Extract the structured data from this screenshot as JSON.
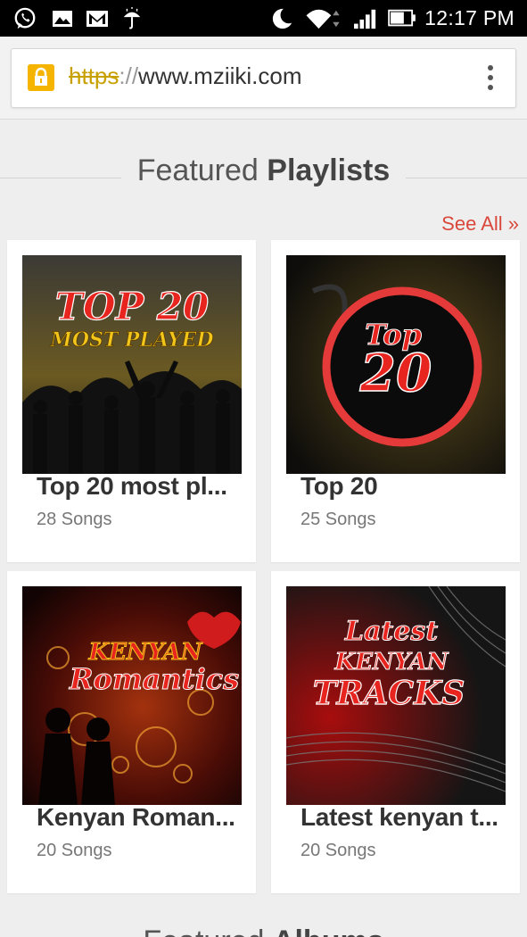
{
  "status_bar": {
    "time": "12:17 PM",
    "icons": [
      "whatsapp-icon",
      "gallery-icon",
      "gmail-icon",
      "umbrella-icon",
      "moon-icon",
      "wifi-icon",
      "signal-icon",
      "battery-icon"
    ]
  },
  "browser": {
    "url_scheme": "https",
    "url_separator": "://",
    "url_host": "www.mziiki.com",
    "lock_color": "#f4b400"
  },
  "featured": {
    "title_light": "Featured",
    "title_bold": "Playlists",
    "see_all": "See All »",
    "accent": "#d9483b",
    "playlists": [
      {
        "title": "Top 20 most pl...",
        "count": "28 Songs",
        "art_lines": [
          "TOP 20",
          "MOST PLAYED"
        ]
      },
      {
        "title": "Top 20",
        "count": "25 Songs",
        "art_lines": [
          "Top",
          "20"
        ]
      },
      {
        "title": "Kenyan Roman...",
        "count": "20 Songs",
        "art_lines": [
          "KENYAN",
          "Romantics"
        ]
      },
      {
        "title": "Latest kenyan t...",
        "count": "20 Songs",
        "art_lines": [
          "Latest",
          "KENYAN",
          "TRACKS"
        ]
      }
    ]
  },
  "next_section": {
    "title_light": "Featured",
    "title_bold": "Albums"
  }
}
